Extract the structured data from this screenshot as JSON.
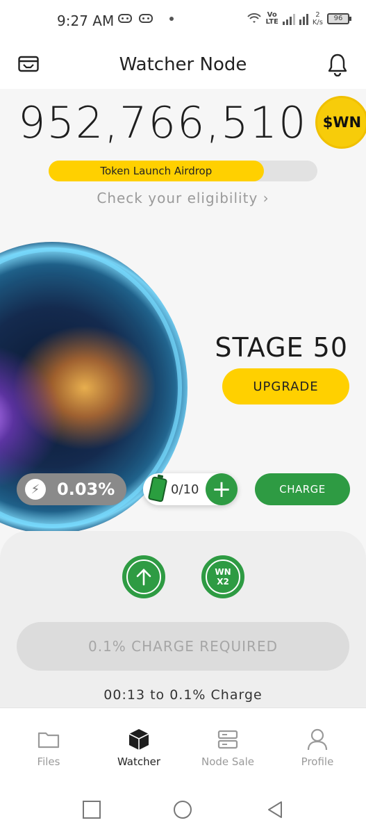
{
  "status_bar": {
    "time": "9:27 AM",
    "network_top": "Vo",
    "network_bottom": "LTE",
    "speed_value": "2",
    "speed_unit": "K/s",
    "battery": "96"
  },
  "header": {
    "title": "Watcher Node",
    "left_icon": "wallet-icon",
    "right_icon": "bell-icon"
  },
  "balance": {
    "amount": "952,766,510",
    "token_symbol": "$WN",
    "token_color": "#f7cc0a"
  },
  "airdrop": {
    "label": "Token Launch Airdrop",
    "progress": 0.8,
    "link_text": "Check your eligibility ›"
  },
  "stage": {
    "label": "STAGE 50",
    "upgrade_label": "UPGRADE"
  },
  "charge_stats": {
    "percent": "0.03%",
    "battery_count": "0/10",
    "add_label": "+",
    "charge_label": "CHARGE"
  },
  "actions": {
    "boost_icon": "arrow-up-icon",
    "multiplier_top": "WN",
    "multiplier_bottom": "X2",
    "charge_required_label": "0.1% CHARGE REQUIRED",
    "countdown": "00:13 to 0.1% Charge"
  },
  "nav": {
    "items": [
      {
        "label": "Files",
        "icon": "folder-icon",
        "active": false
      },
      {
        "label": "Watcher",
        "icon": "cube-icon",
        "active": true
      },
      {
        "label": "Node Sale",
        "icon": "server-icon",
        "active": false
      },
      {
        "label": "Profile",
        "icon": "person-icon",
        "active": false
      }
    ]
  },
  "colors": {
    "accent_yellow": "#ffd000",
    "accent_green": "#2e9b43"
  }
}
